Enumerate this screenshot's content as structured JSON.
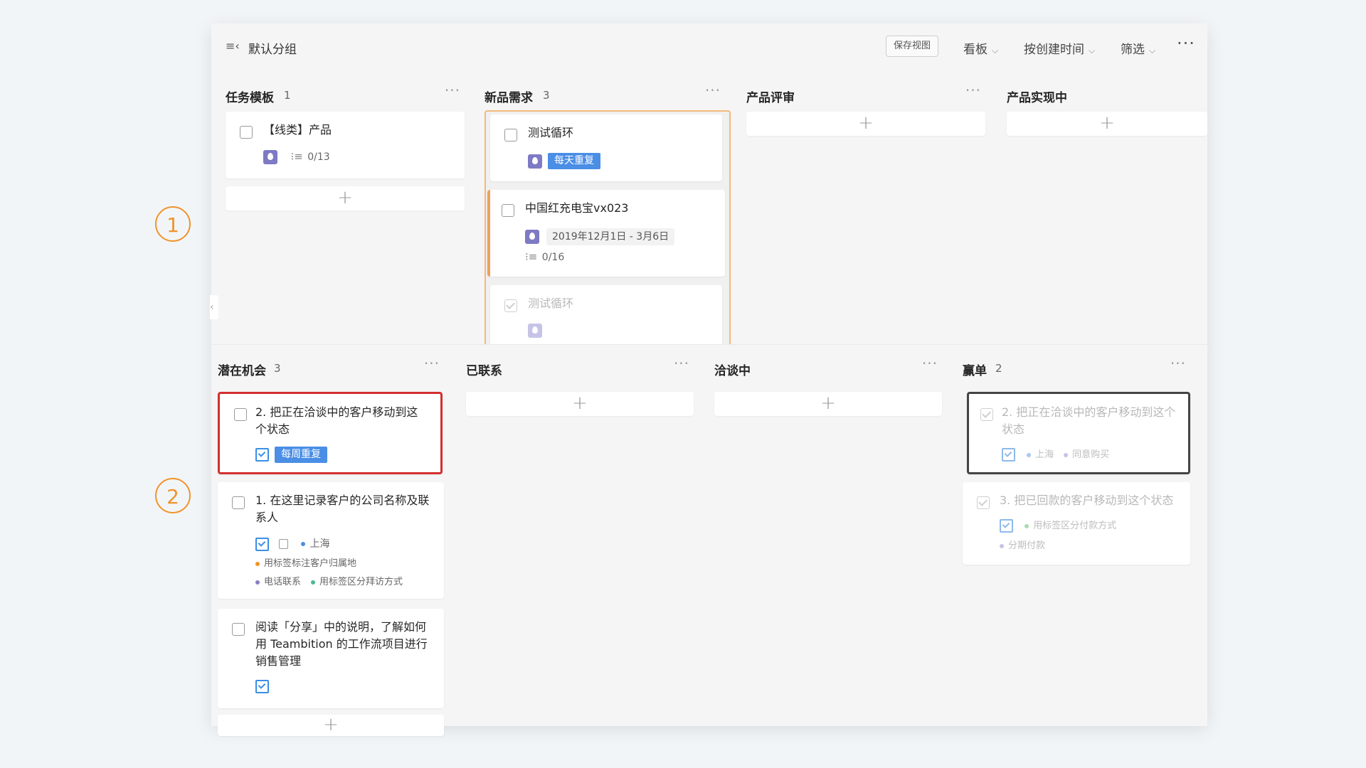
{
  "badges": [
    "1",
    "2"
  ],
  "topbar": {
    "group_icon": "≡‹",
    "group_title": "默认分组",
    "save_view": "保存视图",
    "view_mode": "看板",
    "sort": "按创建时间",
    "filter": "筛选",
    "more": "···",
    "chevron": "⌵"
  },
  "colors": {
    "accent": "#4a8ee6",
    "badge": "#f0932b",
    "highlight_red": "#d32f2f",
    "highlight_dark": "#444444",
    "drag_outline": "#f5b97a"
  },
  "upper": {
    "columns": [
      {
        "title": "任务模板",
        "count": "1",
        "cards": [
          {
            "title": "【线类】产品",
            "icon": "drop-icon",
            "subtasks": "0/13"
          }
        ]
      },
      {
        "title": "新品需求",
        "count": "3",
        "cards": [
          {
            "title": "测试循环",
            "icon": "drop-icon",
            "tag": "每天重复"
          },
          {
            "title": "中国红充电宝vx023",
            "icon": "drop-icon",
            "date": "2019年12月1日 - 3月6日",
            "subtasks": "0/16"
          },
          {
            "title": "测试循环",
            "icon": "drop-icon",
            "done": true
          }
        ]
      },
      {
        "title": "产品评审",
        "count": ""
      },
      {
        "title": "产品实现中",
        "count": ""
      }
    ],
    "add_symbol": "+"
  },
  "lower": {
    "columns": [
      {
        "title": "潜在机会",
        "count": "3",
        "cards": [
          {
            "title": "2. 把正在洽谈中的客户移动到这个状态",
            "icon": "task-icon",
            "tag": "每周重复"
          },
          {
            "title": "1. 在这里记录客户的公司名称及联系人",
            "icon": "task-icon",
            "labels": [
              "上海",
              "用标签标注客户归属地",
              "电话联系",
              "用标签区分拜访方式"
            ]
          },
          {
            "title": "阅读「分享」中的说明，了解如何用 Teambition 的工作流项目进行销售管理",
            "icon": "task-icon"
          }
        ]
      },
      {
        "title": "已联系",
        "count": ""
      },
      {
        "title": "洽谈中",
        "count": ""
      },
      {
        "title": "赢单",
        "count": "2",
        "cards": [
          {
            "title": "2. 把正在洽谈中的客户移动到这个状态",
            "icon": "task-icon",
            "labels": [
              "上海",
              "同意购买"
            ],
            "done": true
          },
          {
            "title": "3. 把已回款的客户移动到这个状态",
            "icon": "task-icon",
            "labels": [
              "用标签区分付款方式",
              "分期付款"
            ],
            "done": true
          }
        ]
      }
    ]
  }
}
